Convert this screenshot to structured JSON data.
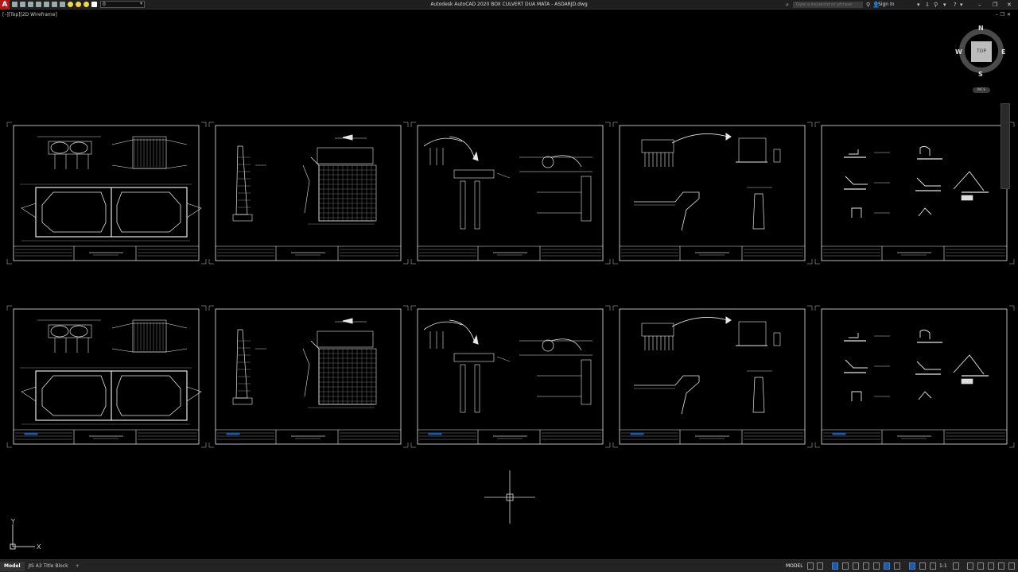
{
  "titlebar": {
    "app_letter": "A",
    "layer_value": "0",
    "title": "Autodesk AutoCAD 2020    BOX CULVERT DUA MATA - ASDARJD.dwg",
    "search_placeholder": "Type a keyword or phrase",
    "sign_in": "Sign In",
    "win_minimize": "–",
    "win_restore": "❐",
    "win_close": "✕",
    "glyph_binoculars": "⌕",
    "glyph_user": "👤",
    "glyph_cart": "⇩",
    "glyph_network": "⚲",
    "glyph_help": "?",
    "glyph_dd": "▾"
  },
  "viewport": {
    "label": "[–][Top][2D Wireframe]",
    "doc_controls": "–❐✕"
  },
  "viewcube": {
    "face": "TOP",
    "north": "N",
    "south": "S",
    "east": "E",
    "west": "W",
    "wcs": "WCS"
  },
  "ucs": {
    "x": "X",
    "y": "Y"
  },
  "tabs": {
    "model": "Model",
    "layout1": "JIS A3 Title Block",
    "add": "+"
  },
  "status": {
    "model": "MODEL",
    "scale": "1:1"
  },
  "colors": {
    "accent": "#1e5aa8",
    "app_red": "#b01919",
    "sheet_line": "#ffffff",
    "background": "#000000"
  }
}
